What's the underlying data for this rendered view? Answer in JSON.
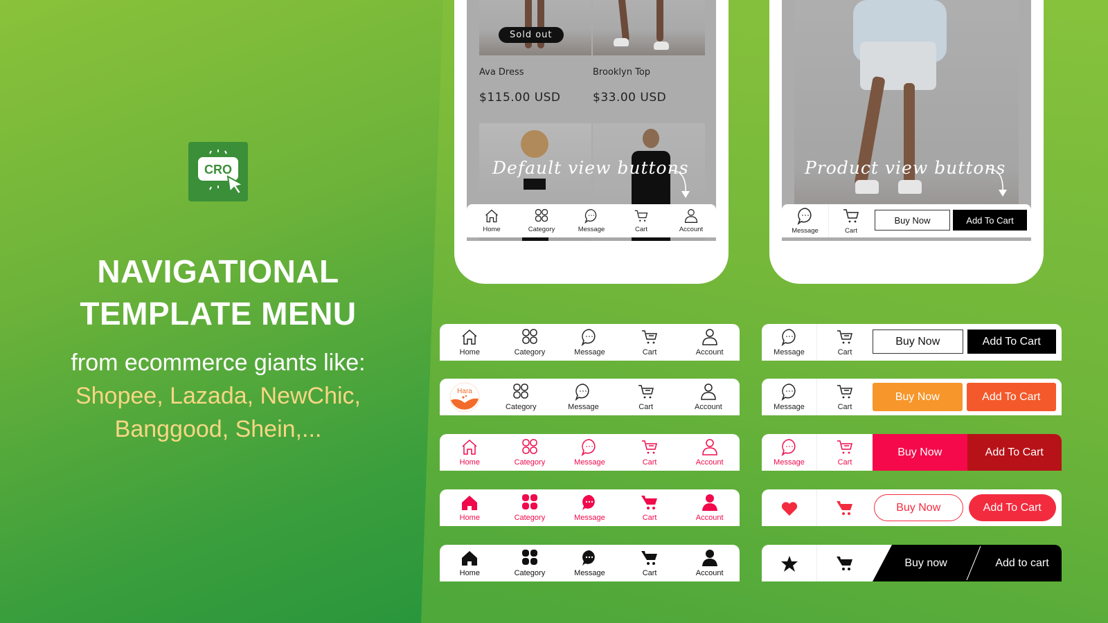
{
  "hero": {
    "logo_text": "CRO",
    "headline_line1": "NAVIGATIONAL",
    "headline_line2": "TEMPLATE MENU",
    "subtitle": "from ecommerce giants like:",
    "brands_line1": "Shopee, Lazada, NewChic,",
    "brands_line2": "Banggood, Shein,..."
  },
  "phone_default": {
    "sold_out_badge": "Sold out",
    "products": [
      {
        "name": "Ava Dress",
        "price": "$115.00 USD"
      },
      {
        "name": "Brooklyn Top",
        "price": "$33.00 USD"
      }
    ],
    "annotation": "Default view buttons",
    "nav": [
      "Home",
      "Category",
      "Message",
      "Cart",
      "Account"
    ]
  },
  "phone_product": {
    "annotation": "Product view buttons",
    "icons": [
      "Message",
      "Cart"
    ],
    "buy_now": "Buy Now",
    "add_to_cart": "Add To Cart"
  },
  "nav_templates": [
    {
      "style": "outline-black",
      "color": "#222222",
      "items": [
        "Home",
        "Category",
        "Message",
        "Cart",
        "Account"
      ]
    },
    {
      "style": "logo-outline-black",
      "color": "#222222",
      "logo_text": "Hara",
      "items": [
        "Category",
        "Message",
        "Cart",
        "Account"
      ]
    },
    {
      "style": "outline-red",
      "color": "#f0094b",
      "items": [
        "Home",
        "Category",
        "Message",
        "Cart",
        "Account"
      ]
    },
    {
      "style": "filled-red",
      "color": "#f0094b",
      "items": [
        "Home",
        "Category",
        "Message",
        "Cart",
        "Account"
      ]
    },
    {
      "style": "filled-black",
      "color": "#111111",
      "items": [
        "Home",
        "Category",
        "Message",
        "Cart",
        "Account"
      ]
    }
  ],
  "action_templates": [
    {
      "icons": [
        "Message",
        "Cart"
      ],
      "buy_now": "Buy Now",
      "add_to_cart": "Add To Cart",
      "buy_color": "#ffffff",
      "cart_color": "#000000"
    },
    {
      "icons": [
        "Message",
        "Cart"
      ],
      "buy_now": "Buy Now",
      "add_to_cart": "Add To Cart",
      "buy_color": "#f7962b",
      "cart_color": "#f4592b"
    },
    {
      "icons": [
        "Message",
        "Cart"
      ],
      "buy_now": "Buy Now",
      "add_to_cart": "Add To Cart",
      "buy_color": "#f5094a",
      "cart_color": "#b71218"
    },
    {
      "icons": [
        "heart",
        "cart"
      ],
      "buy_now": "Buy Now",
      "add_to_cart": "Add To Cart",
      "buy_color": "#ffffff",
      "cart_color": "#f32b3f"
    },
    {
      "icons": [
        "star",
        "cart"
      ],
      "buy_now": "Buy now",
      "add_to_cart": "Add to cart",
      "buy_color": "#000000",
      "cart_color": "#000000"
    }
  ],
  "colors": {
    "accent_red": "#f0094b",
    "brand_yellow": "#f7d784",
    "logo_green": "#3a8f38"
  }
}
